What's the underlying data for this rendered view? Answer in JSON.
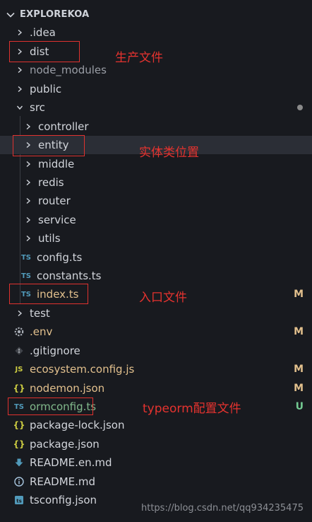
{
  "explorer": {
    "title": "EXPLOREKOA"
  },
  "colors": {
    "modified": "#e2c08d",
    "untracked": "#73c991",
    "annotation": "#e0322f",
    "ts_icon": "#519aba",
    "js_icon": "#cbcb41"
  },
  "tree": [
    {
      "label": "EXPLOREKOA",
      "kind": "root-header"
    },
    {
      "label": ".idea",
      "kind": "folder",
      "indent": 1,
      "state": "collapsed"
    },
    {
      "label": "dist",
      "kind": "folder",
      "indent": 1,
      "state": "collapsed"
    },
    {
      "label": "node_modules",
      "kind": "folder",
      "indent": 1,
      "state": "collapsed"
    },
    {
      "label": "public",
      "kind": "folder",
      "indent": 1,
      "state": "collapsed"
    },
    {
      "label": "src",
      "kind": "folder",
      "indent": 1,
      "state": "expanded"
    },
    {
      "label": "controller",
      "kind": "folder",
      "indent": 2,
      "state": "collapsed"
    },
    {
      "label": "entity",
      "kind": "folder",
      "indent": 2,
      "state": "collapsed"
    },
    {
      "label": "middle",
      "kind": "folder",
      "indent": 2,
      "state": "collapsed"
    },
    {
      "label": "redis",
      "kind": "folder",
      "indent": 2,
      "state": "collapsed"
    },
    {
      "label": "router",
      "kind": "folder",
      "indent": 2,
      "state": "collapsed"
    },
    {
      "label": "service",
      "kind": "folder",
      "indent": 2,
      "state": "collapsed"
    },
    {
      "label": "utils",
      "kind": "folder",
      "indent": 2,
      "state": "collapsed"
    },
    {
      "label": "config.ts",
      "kind": "file",
      "indent": 2,
      "icon": "ts-icon"
    },
    {
      "label": "constants.ts",
      "kind": "file",
      "indent": 2,
      "icon": "ts-icon"
    },
    {
      "label": "index.ts",
      "kind": "file",
      "indent": 2,
      "icon": "ts-icon",
      "status": "M"
    },
    {
      "label": "test",
      "kind": "folder",
      "indent": 1,
      "state": "collapsed"
    },
    {
      "label": ".env",
      "kind": "file",
      "indent": 1,
      "icon": "gear-icon",
      "status": "M"
    },
    {
      "label": ".gitignore",
      "kind": "file",
      "indent": 1,
      "icon": "git-icon"
    },
    {
      "label": "ecosystem.config.js",
      "kind": "file",
      "indent": 1,
      "icon": "js-icon",
      "status": "M"
    },
    {
      "label": "nodemon.json",
      "kind": "file",
      "indent": 1,
      "icon": "json-icon",
      "status": "M"
    },
    {
      "label": "ormconfig.ts",
      "kind": "file",
      "indent": 1,
      "icon": "ts-icon",
      "status": "U"
    },
    {
      "label": "package-lock.json",
      "kind": "file",
      "indent": 1,
      "icon": "json-icon"
    },
    {
      "label": "package.json",
      "kind": "file",
      "indent": 1,
      "icon": "json-icon"
    },
    {
      "label": "README.en.md",
      "kind": "file",
      "indent": 1,
      "icon": "download-icon"
    },
    {
      "label": "README.md",
      "kind": "file",
      "indent": 1,
      "icon": "info-icon"
    },
    {
      "label": "tsconfig.json",
      "kind": "file",
      "indent": 1,
      "icon": "ts-icon"
    }
  ],
  "icon_text": {
    "ts": "TS",
    "js": "JS",
    "json": "{}"
  },
  "annotations": {
    "dist": "生产文件",
    "entity": "实体类位置",
    "index": "入口文件",
    "ormconfig": "typeorm配置文件"
  },
  "statuses": {
    "index": "M",
    "env": "M",
    "ecosystem": "M",
    "nodemon": "M",
    "ormconfig": "U"
  },
  "watermark": "https://blog.csdn.net/qq934235475"
}
